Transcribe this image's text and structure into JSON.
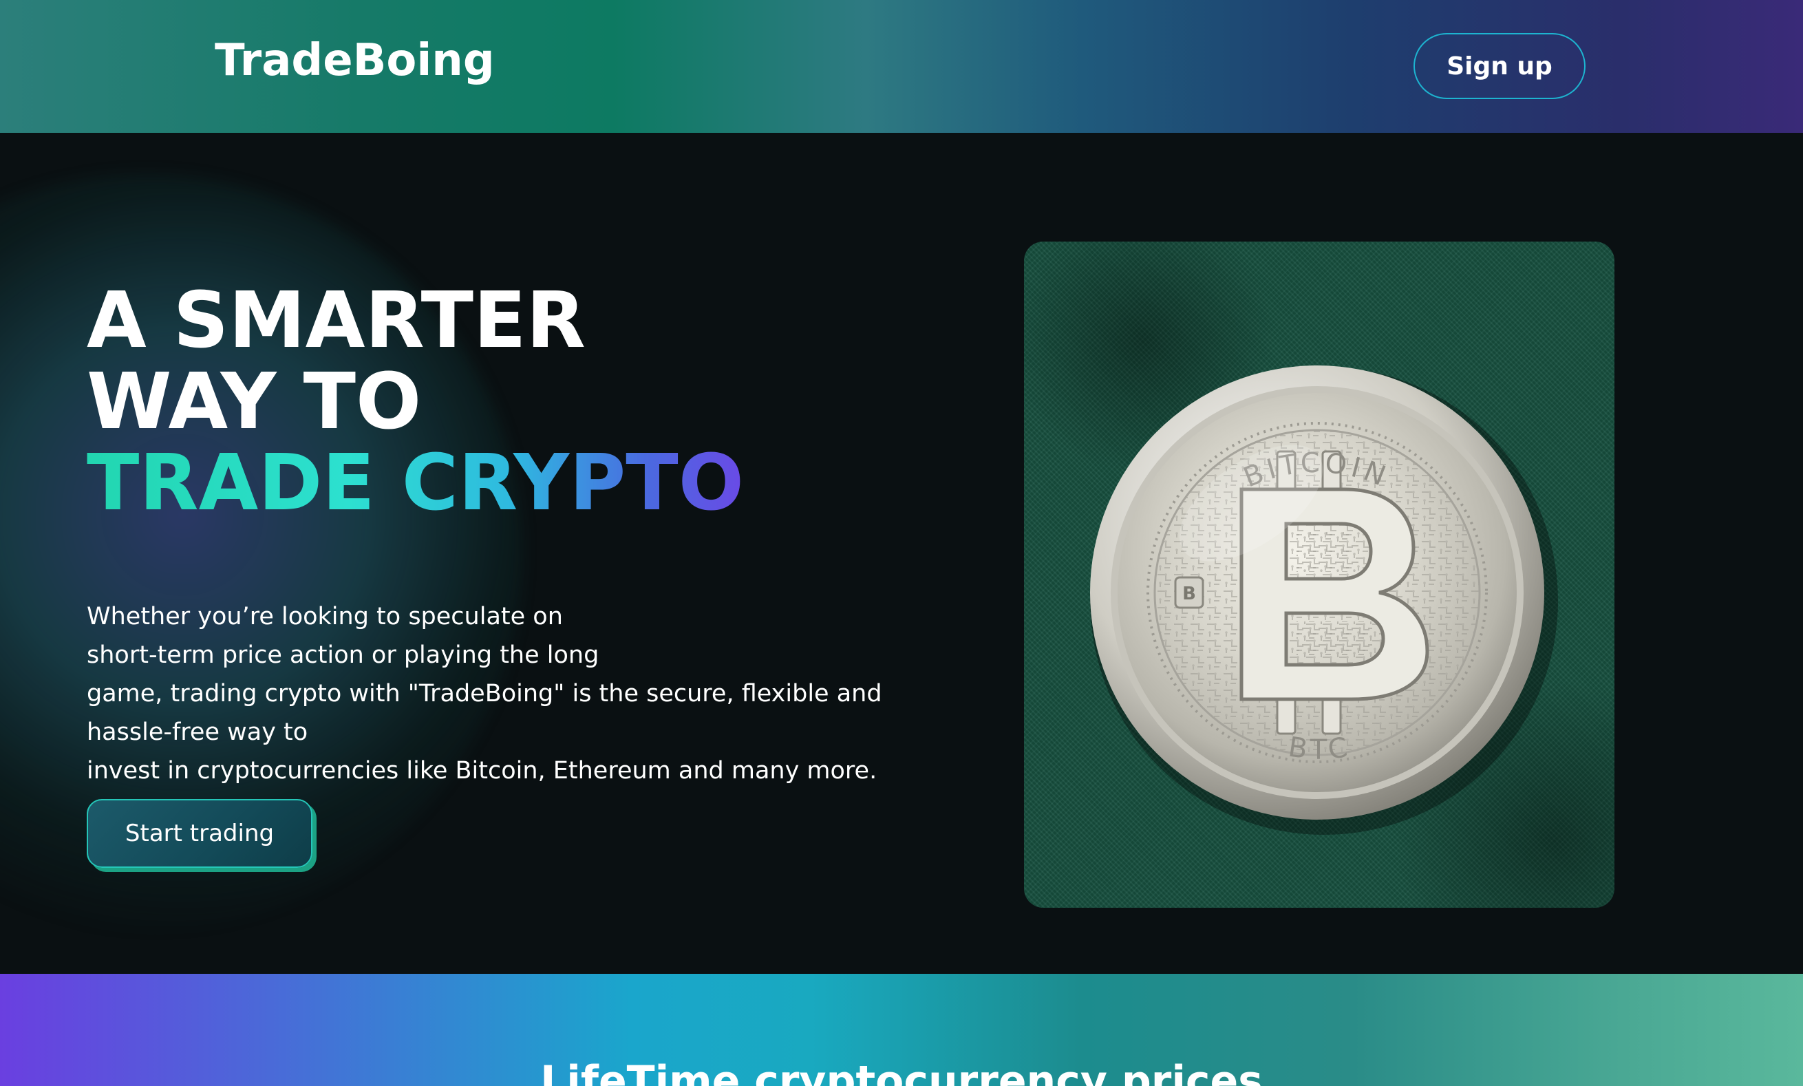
{
  "header": {
    "brand": "TradeBoing",
    "signup_label": "Sign up"
  },
  "hero": {
    "headline": {
      "line1": "A SMARTER",
      "line2": "WAY TO",
      "line3": "TRADE CRYPTO"
    },
    "description": {
      "line1": "Whether you’re looking to speculate on",
      "line2": "short-term price action or playing the long",
      "line3": "game, trading crypto with \"TradeBoing\" is the secure, flexible and",
      "line4": "hassle-free way to",
      "line5": "invest in cryptocurrencies like Bitcoin, Ethereum and many more."
    },
    "cta_label": "Start trading",
    "image": {
      "coin_top_text": "BITCOIN",
      "coin_bottom_text": "BTC"
    }
  },
  "banner": {
    "title": "LifeTime cryptocurrency prices"
  },
  "colors": {
    "accent_teal": "#22d6b0",
    "accent_purple": "#6a4ae6",
    "background": "#0a1012",
    "signup_border": "#1db4d0"
  }
}
